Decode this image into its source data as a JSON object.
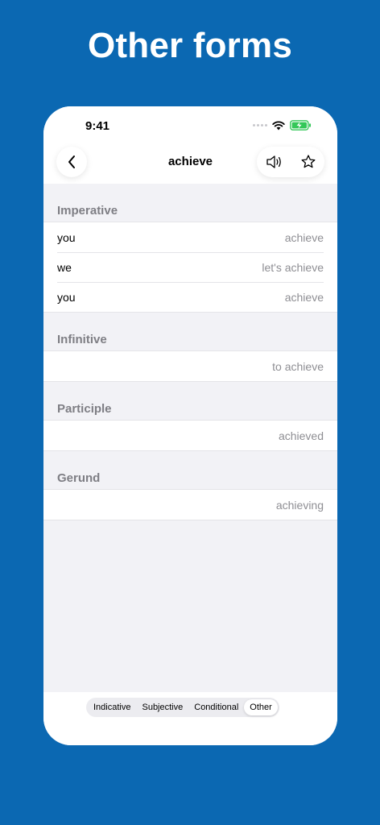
{
  "headline": "Other forms",
  "status": {
    "time": "9:41"
  },
  "nav": {
    "title": "achieve"
  },
  "sections": {
    "imperative": {
      "title": "Imperative",
      "rows": [
        {
          "label": "you",
          "value": "achieve"
        },
        {
          "label": "we",
          "value": "let's achieve"
        },
        {
          "label": "you",
          "value": "achieve"
        }
      ]
    },
    "infinitive": {
      "title": "Infinitive",
      "value": "to achieve"
    },
    "participle": {
      "title": "Participle",
      "value": "achieved"
    },
    "gerund": {
      "title": "Gerund",
      "value": "achieving"
    }
  },
  "tabs": [
    {
      "label": "Indicative",
      "active": false
    },
    {
      "label": "Subjective",
      "active": false
    },
    {
      "label": "Conditional",
      "active": false
    },
    {
      "label": "Other",
      "active": true
    }
  ],
  "colors": {
    "background": "#0b68b2",
    "battery": "#34c759",
    "secondary_text": "#8e8e93"
  },
  "icons": [
    "back-chevron-icon",
    "speaker-icon",
    "star-icon",
    "wifi-icon",
    "battery-charging-icon"
  ]
}
